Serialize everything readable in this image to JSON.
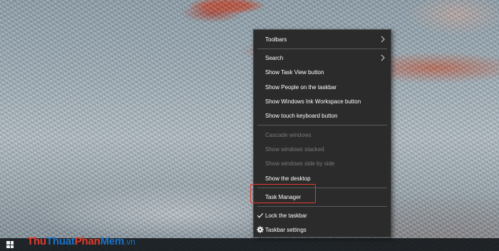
{
  "context_menu": {
    "items": [
      {
        "label": "Toolbars",
        "enabled": true,
        "submenu": true
      },
      {
        "label": "Search",
        "enabled": true,
        "submenu": true
      },
      {
        "label": "Show Task View button",
        "enabled": true
      },
      {
        "label": "Show People on the taskbar",
        "enabled": true
      },
      {
        "label": "Show Windows Ink Workspace button",
        "enabled": true
      },
      {
        "label": "Show touch keyboard button",
        "enabled": true
      },
      {
        "label": "Cascade windows",
        "enabled": false
      },
      {
        "label": "Show windows stacked",
        "enabled": false
      },
      {
        "label": "Show windows side by side",
        "enabled": false
      },
      {
        "label": "Show the desktop",
        "enabled": true
      },
      {
        "label": "Task Manager",
        "enabled": true
      },
      {
        "label": "Lock the taskbar",
        "enabled": true,
        "checked": true
      },
      {
        "label": "Taskbar settings",
        "enabled": true,
        "icon": "gear-icon"
      }
    ]
  },
  "watermark": {
    "part1": "Thu",
    "part2": "Thuat",
    "part3": "Phan",
    "part4": "Mem",
    "part5": ".vn"
  },
  "colors": {
    "menu_bg": "#2b2b2b",
    "menu_text": "#ffffff",
    "menu_disabled_text": "#7a7a7a",
    "highlight": "#e23b2e",
    "watermark_red": "#e13a2d",
    "watermark_blue": "#1b74c6"
  },
  "icons": {
    "start": "windows-logo-icon",
    "submenu": "chevron-right-icon",
    "check": "checkmark-icon",
    "settings": "gear-icon"
  }
}
